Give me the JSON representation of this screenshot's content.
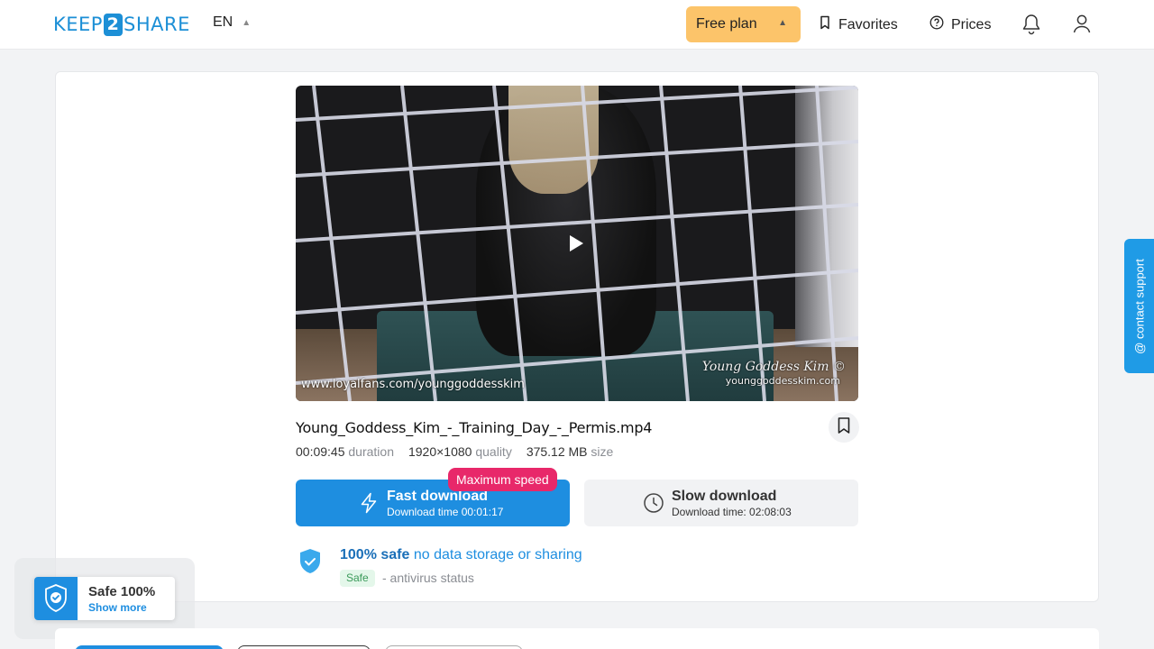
{
  "header": {
    "logo_left": "KEEP",
    "logo_mid": "2",
    "logo_right": "SHARE",
    "language": "EN",
    "plan_label": "Free plan",
    "favorites_label": "Favorites",
    "prices_label": "Prices"
  },
  "video": {
    "watermark_left": "www.loyalfans.com/younggoddesskim",
    "watermark_right": "Young Goddess Kim ©",
    "watermark_right_url": "younggoddesskim.com"
  },
  "file": {
    "name": "Young_Goddess_Kim_-_Training_Day_-_Permis.mp4",
    "duration_value": "00:09:45",
    "duration_label": "duration",
    "quality_value": "1920×1080",
    "quality_label": "quality",
    "size_value": "375.12 MB",
    "size_label": "size"
  },
  "download": {
    "badge": "Maximum speed",
    "fast_title": "Fast download",
    "fast_sub": "Download time 00:01:17",
    "slow_title": "Slow download",
    "slow_sub": "Download time: 02:08:03"
  },
  "safety": {
    "title_bold": "100% safe",
    "title_rest": " no data storage or sharing",
    "chip": "Safe",
    "status": "- antivirus status"
  },
  "support_label": "@ contact support",
  "popup": {
    "title": "Safe 100%",
    "link": "Show more"
  },
  "colors": {
    "accent": "#1e8ee0",
    "plan_bg": "#fcc46a",
    "badge": "#e8286a"
  }
}
